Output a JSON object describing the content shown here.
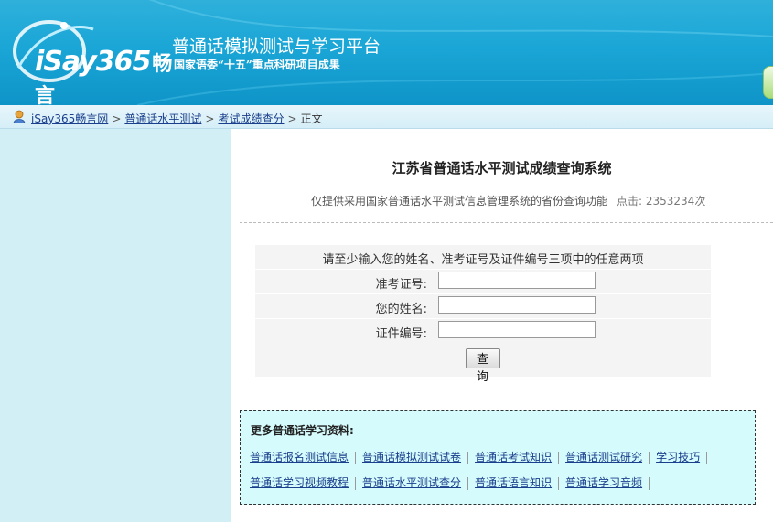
{
  "header": {
    "logo_text": "iSay365",
    "logo_cn": "畅言",
    "site_title": "普通话模拟测试与学习平台",
    "site_subtitle": "国家语委“十五”重点科研项目成果"
  },
  "breadcrumb": {
    "items": [
      "iSay365畅言网",
      "普通话水平测试",
      "考试成绩查分"
    ],
    "current": "正文",
    "separator": ">"
  },
  "main": {
    "title": "江苏省普通话水平测试成绩查询系统",
    "description": "仅提供采用国家普通话水平测试信息管理系统的省份查询功能",
    "clicks_label": "点击: 2353234次"
  },
  "form": {
    "tip": "请至少输入您的姓名、准考证号及证件编号三项中的任意两项",
    "fields": [
      {
        "label": "准考证号:",
        "value": ""
      },
      {
        "label": "您的姓名:",
        "value": ""
      },
      {
        "label": "证件编号:",
        "value": ""
      }
    ],
    "submit_label": "查 询"
  },
  "more": {
    "title": "更多普通话学习资料:",
    "row1": [
      "普通话报名测试信息",
      "普通话模拟测试试卷",
      "普通话考试知识",
      "普通话测试研究",
      "学习技巧"
    ],
    "row2": [
      "普通话学习视频教程",
      "普通话水平测试查分",
      "普通话语言知识",
      "普通话学习音频"
    ]
  },
  "colors": {
    "header_blue": "#1aa6d6",
    "sidebar": "#d2eff6",
    "more_box": "#d5fbfc",
    "link": "#1a3f8c"
  },
  "icons": [
    "logo-swirl-icon",
    "user-icon"
  ]
}
